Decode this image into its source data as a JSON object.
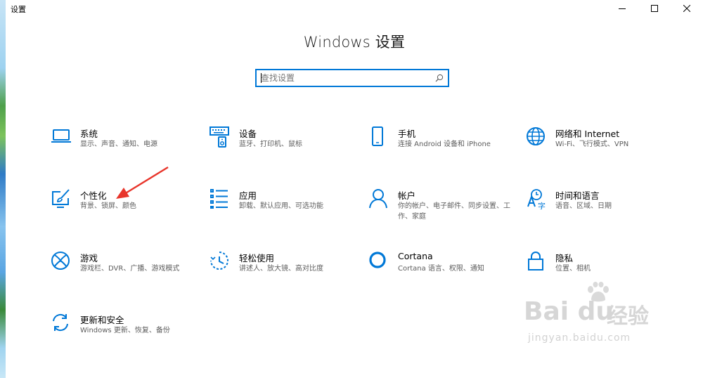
{
  "window": {
    "title": "设置",
    "controls": {
      "minimize": "minimize-icon",
      "maximize": "maximize-icon",
      "close": "close-icon"
    }
  },
  "page_title": "Windows 设置",
  "search": {
    "placeholder": "查找设置",
    "value": "",
    "icon": "search-icon"
  },
  "tiles": [
    {
      "name": "系统",
      "desc": "显示、声音、通知、电源",
      "icon": "laptop-icon"
    },
    {
      "name": "设备",
      "desc": "蓝牙、打印机、鼠标",
      "icon": "keyboard-speaker-icon"
    },
    {
      "name": "手机",
      "desc": "连接 Android 设备和 iPhone",
      "icon": "phone-icon"
    },
    {
      "name": "网络和 Internet",
      "desc": "Wi-Fi、飞行模式、VPN",
      "icon": "globe-icon"
    },
    {
      "name": "个性化",
      "desc": "背景、锁屏、颜色",
      "icon": "paint-brush-icon"
    },
    {
      "name": "应用",
      "desc": "卸载、默认应用、可选功能",
      "icon": "apps-list-icon"
    },
    {
      "name": "帐户",
      "desc": "你的帐户、电子邮件、同步设置、工作、家庭",
      "icon": "person-icon"
    },
    {
      "name": "时间和语言",
      "desc": "语音、区域、日期",
      "icon": "time-language-icon"
    },
    {
      "name": "游戏",
      "desc": "游戏栏、DVR、广播、游戏模式",
      "icon": "xbox-icon"
    },
    {
      "name": "轻松使用",
      "desc": "讲述人、放大镜、高对比度",
      "icon": "ease-of-access-icon"
    },
    {
      "name": "Cortana",
      "desc": "Cortana 语言、权限、通知",
      "icon": "cortana-icon"
    },
    {
      "name": "隐私",
      "desc": "位置、相机",
      "icon": "lock-icon"
    },
    {
      "name": "更新和安全",
      "desc": "Windows 更新、恢复、备份",
      "icon": "sync-arrows-icon"
    }
  ],
  "accent_color": "#0078d7",
  "annotation_color": "#e8352b",
  "watermark": {
    "logo": "Bai du",
    "cn": "经验",
    "url": "jingyan.baidu.com"
  }
}
